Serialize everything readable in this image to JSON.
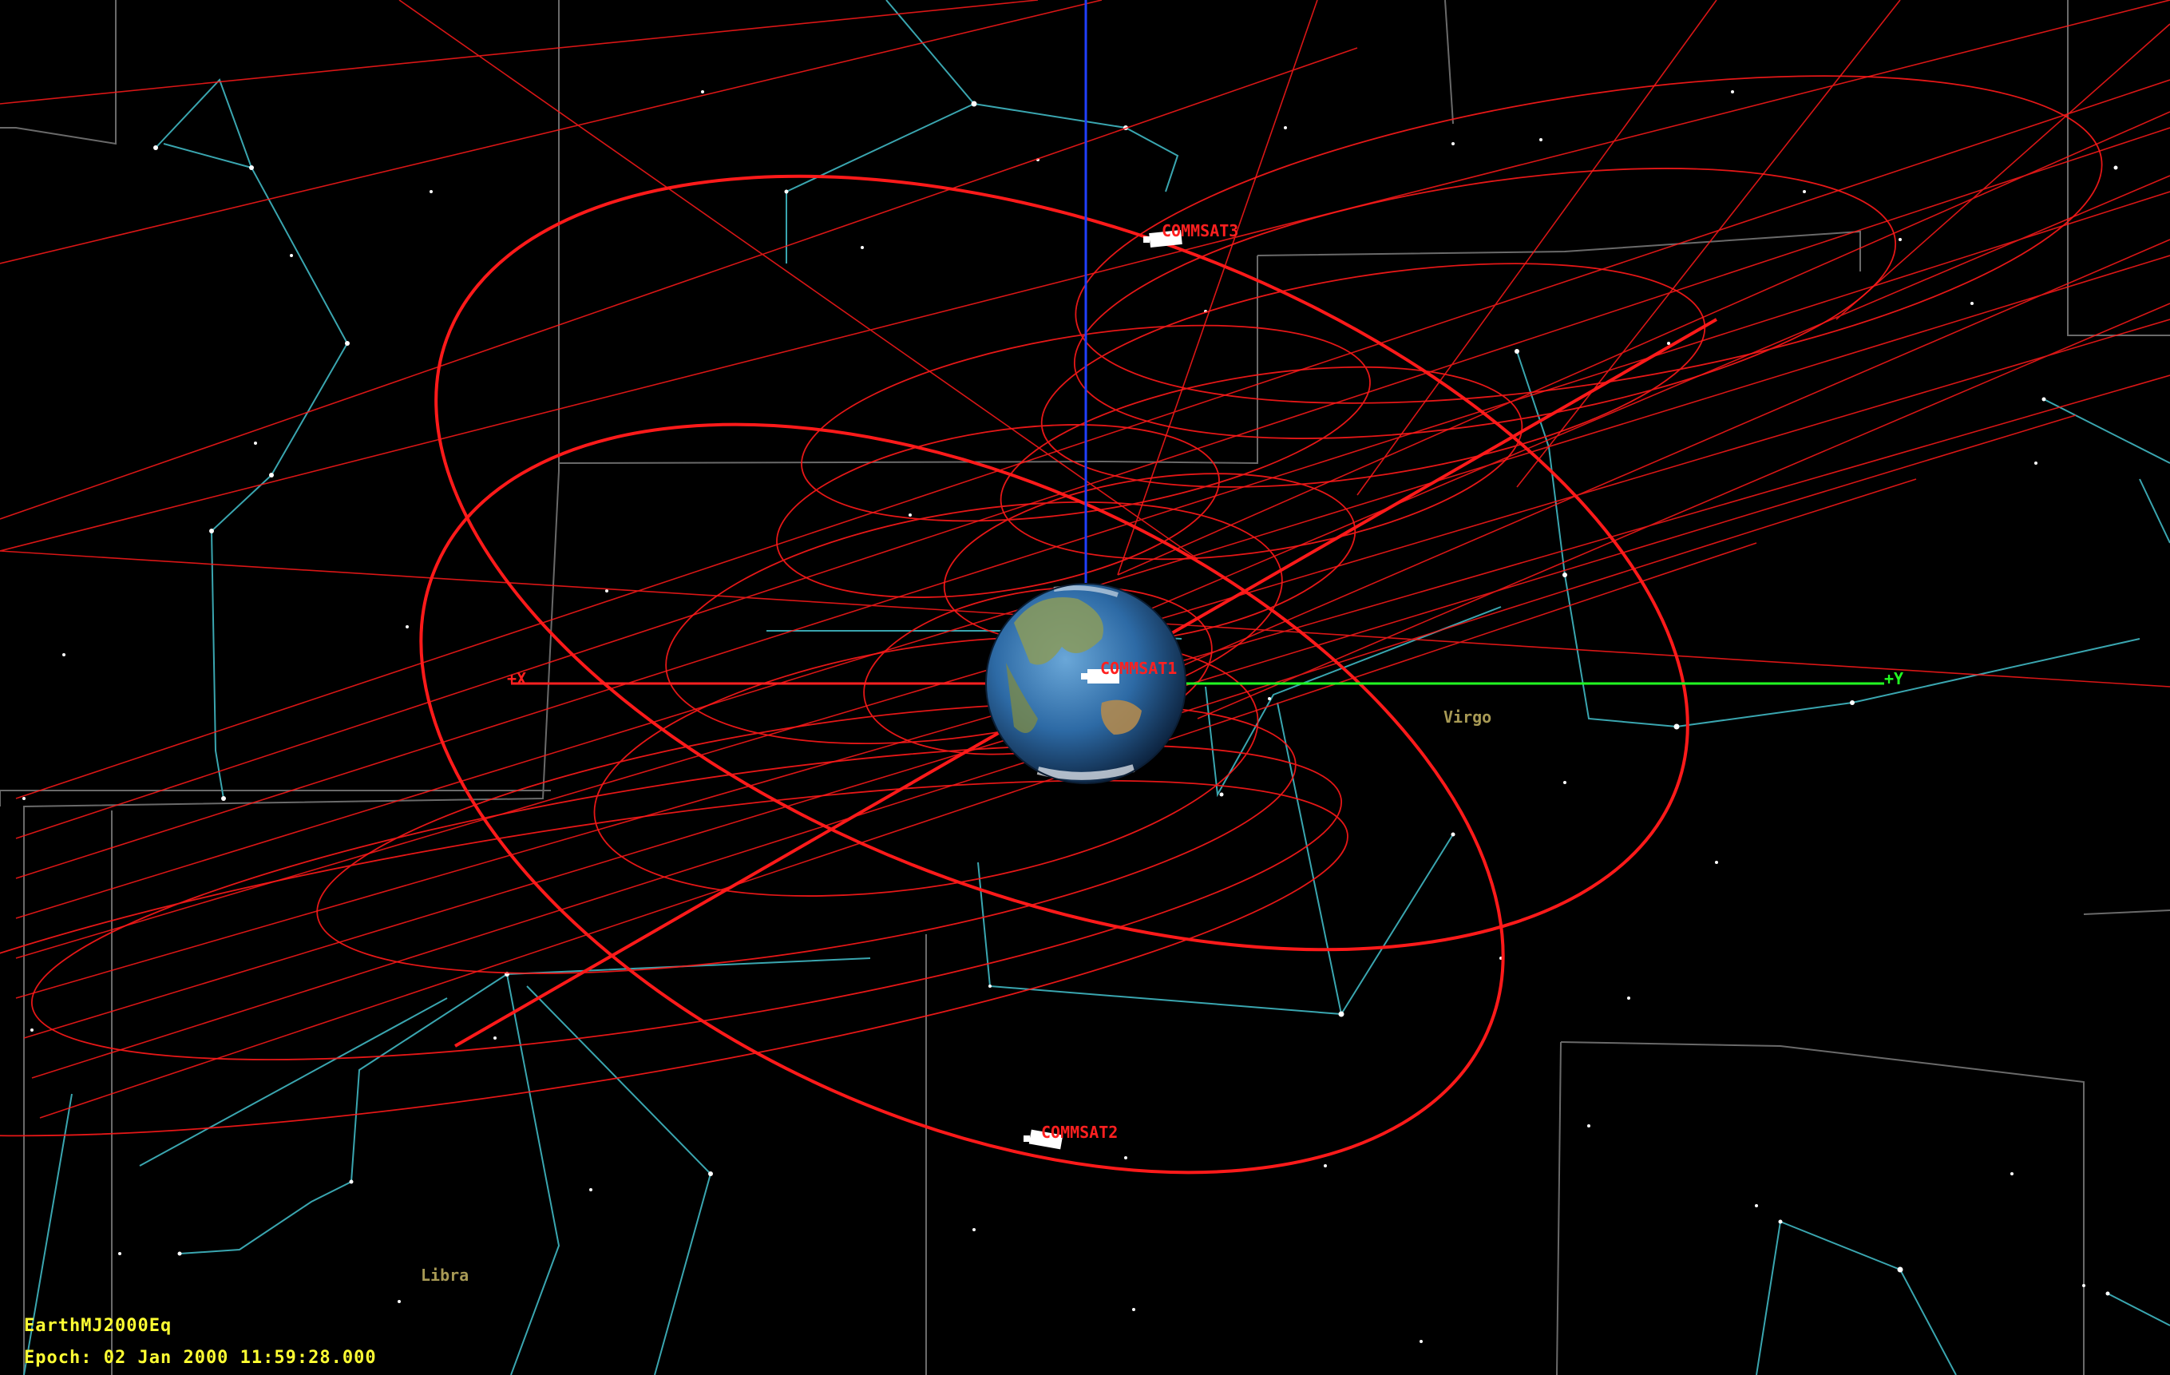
{
  "view": {
    "coordinate_system": "EarthMJ2000Eq",
    "epoch_label": "Epoch:",
    "epoch_value": "02 Jan 2000 11:59:28.000"
  },
  "axes": {
    "x_label": "+X",
    "y_label": "+Y",
    "x_color": "#ff2020",
    "y_color": "#22ff22",
    "z_color": "#2040ff"
  },
  "spacecraft": [
    {
      "name": "COMMSAT1"
    },
    {
      "name": "COMMSAT2"
    },
    {
      "name": "COMMSAT3"
    }
  ],
  "constellations": [
    {
      "name": "Virgo"
    },
    {
      "name": "Libra"
    }
  ],
  "colors": {
    "orbit": "#ff1a1a",
    "constellation_line": "#3aa6b0",
    "constellation_label": "#a89a55",
    "overlay_text": "#ffff33",
    "boundary": "#8a8a8a"
  }
}
